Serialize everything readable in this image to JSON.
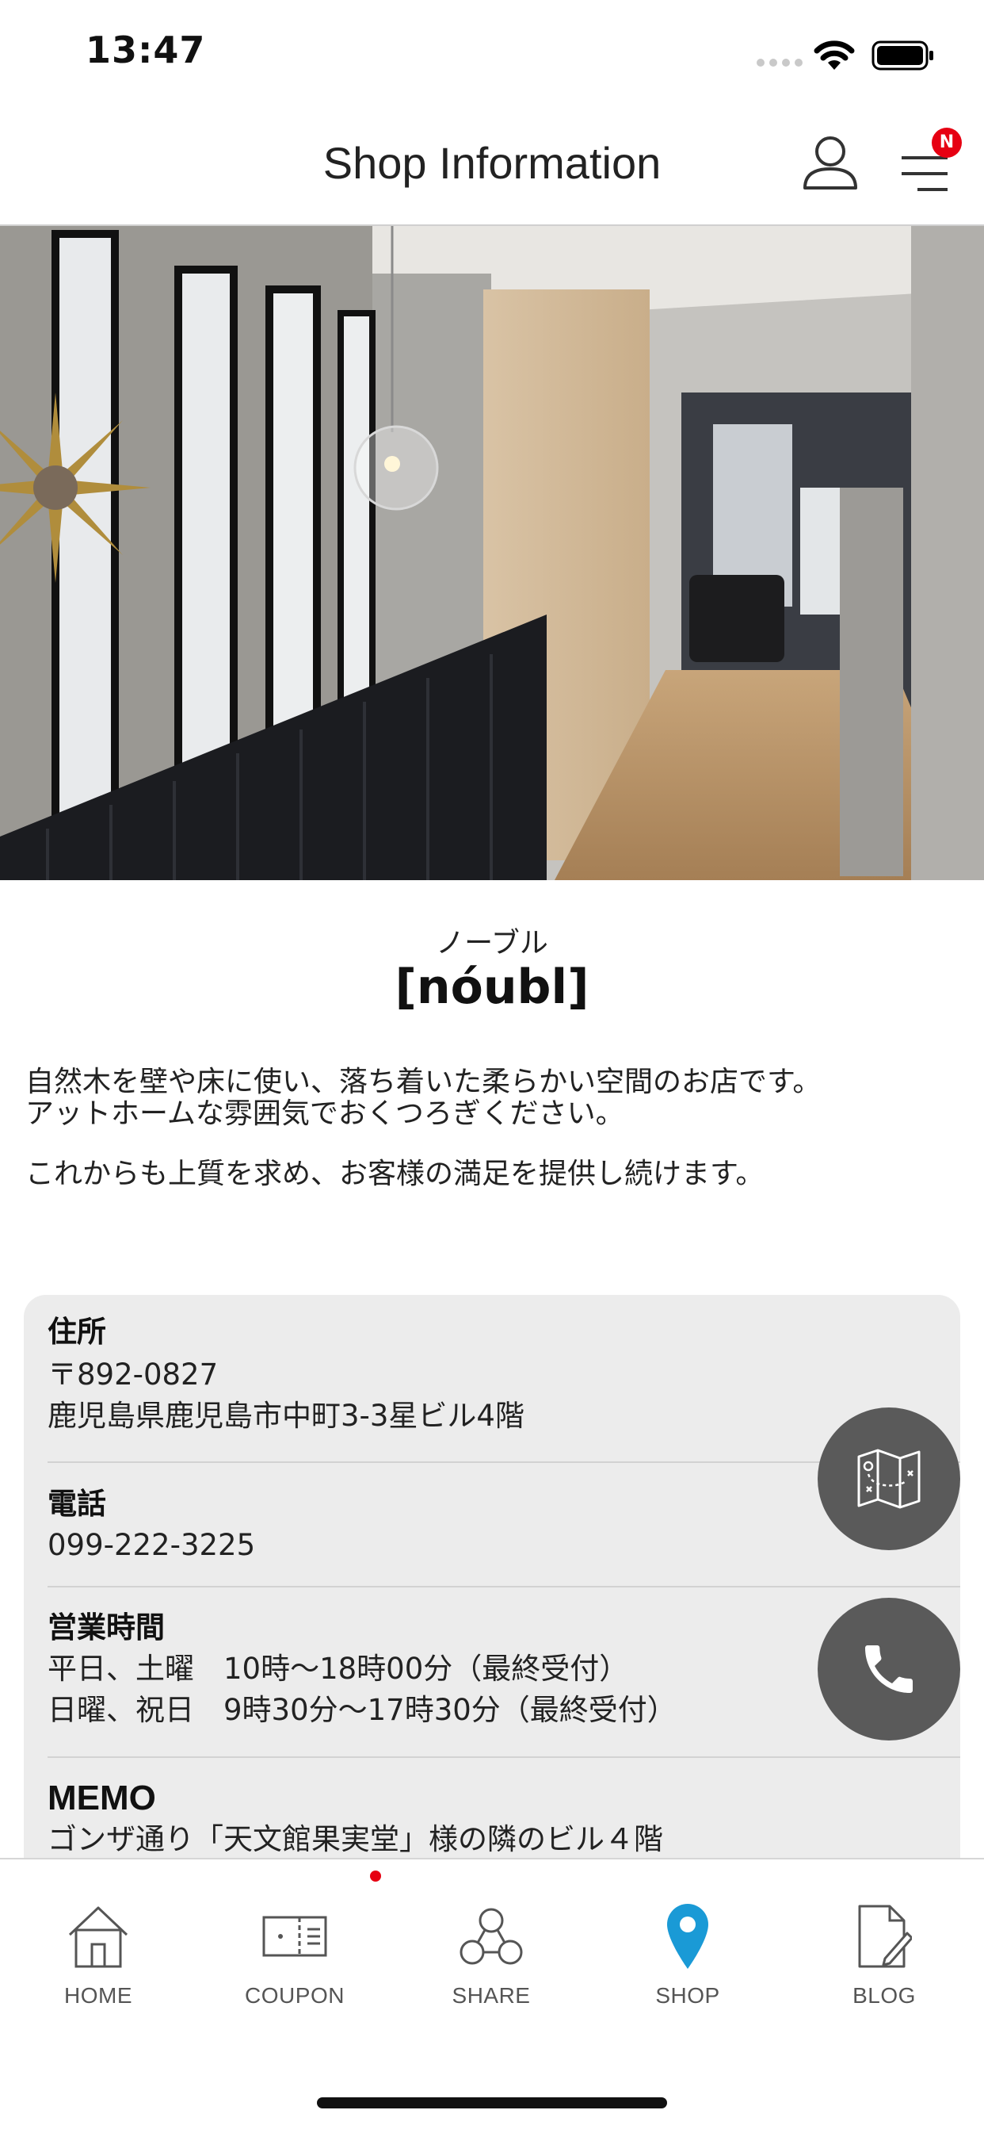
{
  "status_bar": {
    "time": "13:47"
  },
  "header": {
    "title": "Shop Information",
    "menu_badge": "N"
  },
  "shop": {
    "kana": "ノーブル",
    "name": "[nóubl]",
    "description": [
      "自然木を壁や床に使い、落ち着いた柔らかい空間のお店です。",
      "アットホームな雰囲気でおくつろぎください。",
      "これからも上質を求め、お客様の満足を提供し続けます。"
    ]
  },
  "info": {
    "address": {
      "label": "住所",
      "postal": "〒892-0827",
      "line": "鹿児島県鹿児島市中町3-3星ビル4階"
    },
    "phone": {
      "label": "電話",
      "number": "099-222-3225"
    },
    "hours": {
      "label": "営業時間",
      "lines": [
        "平日、土曜　10時～18時00分（最終受付）",
        "日曜、祝日　9時30分～17時30分（最終受付）"
      ]
    },
    "memo": {
      "label": "MEMO",
      "text": "ゴンザ通り「天文館果実堂」様の隣のビル４階"
    }
  },
  "tabs": [
    {
      "label": "HOME",
      "icon": "home-icon"
    },
    {
      "label": "COUPON",
      "icon": "coupon-icon"
    },
    {
      "label": "SHARE",
      "icon": "share-icon"
    },
    {
      "label": "SHOP",
      "icon": "location-pin-icon"
    },
    {
      "label": "BLOG",
      "icon": "blog-icon"
    }
  ],
  "colors": {
    "accent": "#1a9ad6",
    "badge": "#e60012",
    "fab": "#5a5a5a",
    "card": "#ececec"
  }
}
